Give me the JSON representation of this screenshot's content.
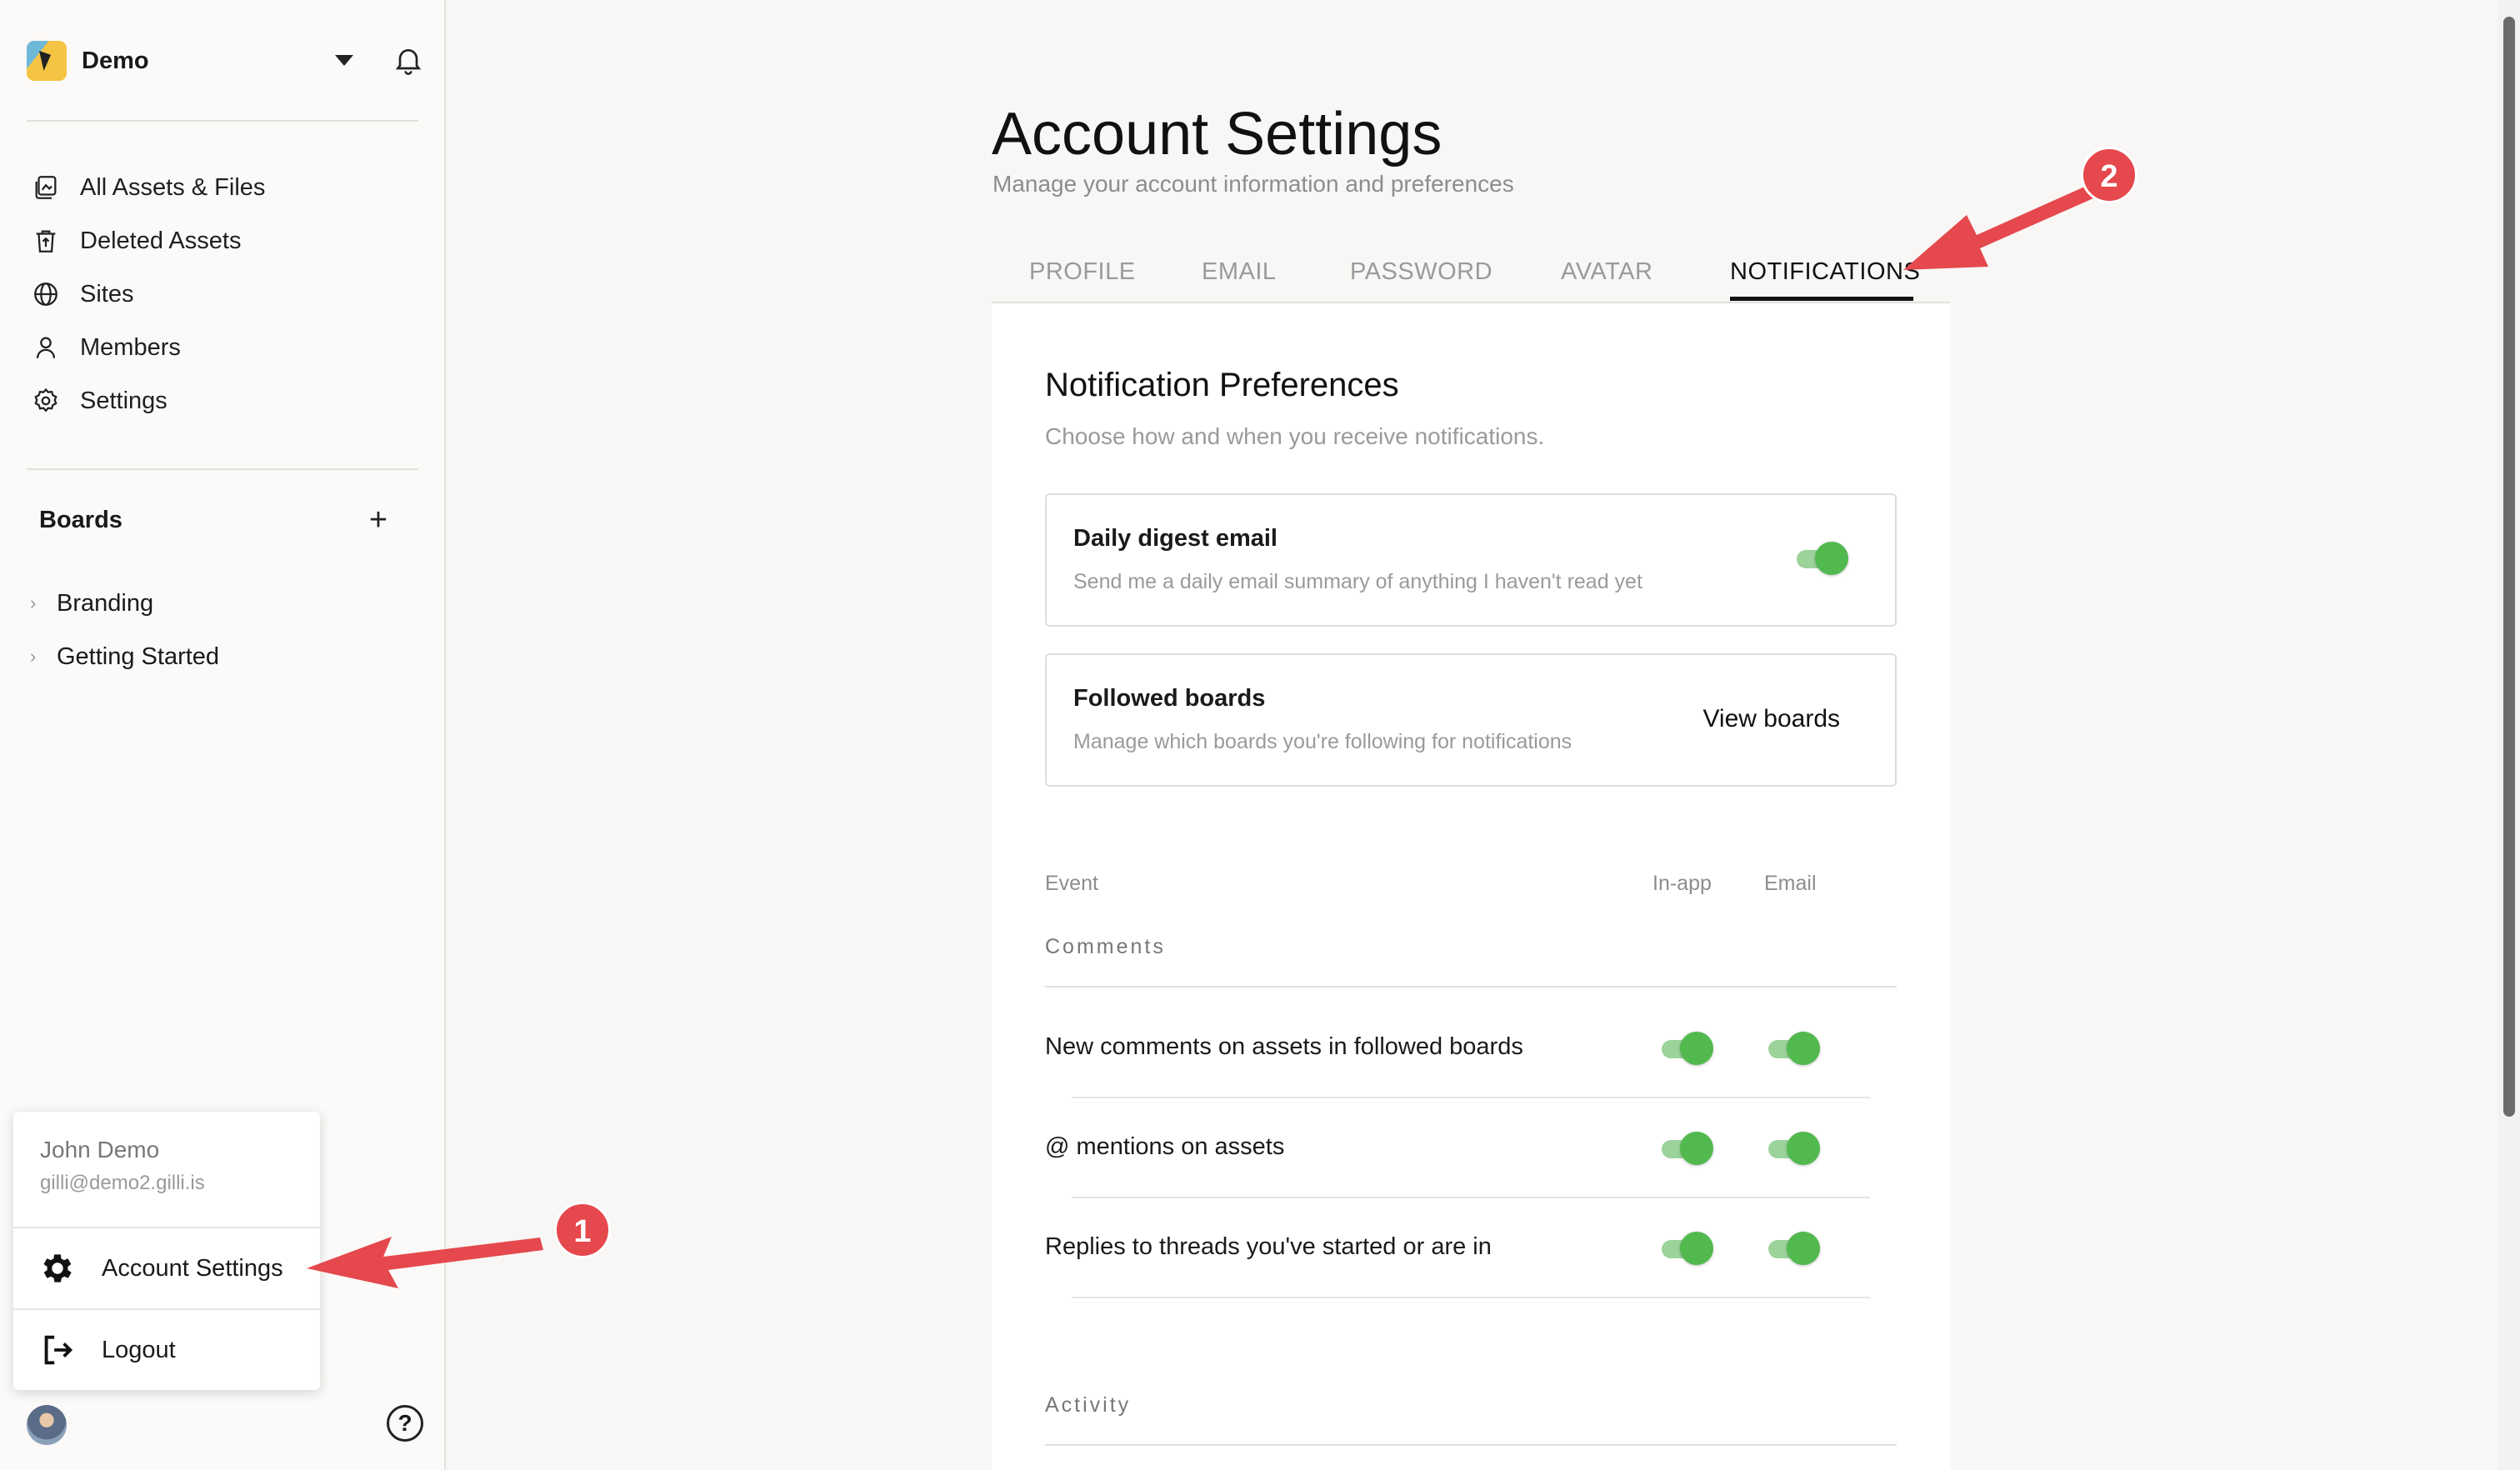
{
  "workspace": {
    "name": "Demo"
  },
  "nav": [
    {
      "label": "All Assets & Files",
      "icon": "assets-icon"
    },
    {
      "label": "Deleted Assets",
      "icon": "trash-icon"
    },
    {
      "label": "Sites",
      "icon": "globe-icon"
    },
    {
      "label": "Members",
      "icon": "person-icon"
    },
    {
      "label": "Settings",
      "icon": "gear-icon"
    }
  ],
  "boards": {
    "title": "Boards",
    "add_label": "+",
    "items": [
      {
        "label": "Branding"
      },
      {
        "label": "Getting Started"
      }
    ]
  },
  "user_menu": {
    "name": "John Demo",
    "email": "gilli@demo2.gilli.is",
    "account_settings": "Account Settings",
    "logout": "Logout"
  },
  "help_label": "?",
  "page": {
    "title": "Account Settings",
    "subtitle": "Manage your account information and preferences",
    "tabs": [
      {
        "label": "PROFILE"
      },
      {
        "label": "EMAIL"
      },
      {
        "label": "PASSWORD"
      },
      {
        "label": "AVATAR"
      },
      {
        "label": "NOTIFICATIONS",
        "active": true
      }
    ]
  },
  "notifications": {
    "title": "Notification Preferences",
    "subtitle": "Choose how and when you receive notifications.",
    "digest": {
      "title": "Daily digest email",
      "subtitle": "Send me a daily email summary of anything I haven't read yet",
      "enabled": true
    },
    "followed": {
      "title": "Followed boards",
      "subtitle": "Manage which boards you're following for notifications",
      "action": "View boards"
    },
    "columns": {
      "event": "Event",
      "inapp": "In-app",
      "email": "Email"
    },
    "groups": [
      {
        "label": "Comments",
        "rows": [
          {
            "label": "New comments on assets in followed boards",
            "inapp": true,
            "email": true
          },
          {
            "label": "@ mentions on assets",
            "inapp": true,
            "email": true
          },
          {
            "label": "Replies to threads you've started or are in",
            "inapp": true,
            "email": true
          }
        ]
      },
      {
        "label": "Activity",
        "rows": []
      }
    ]
  },
  "annotations": {
    "step1": "1",
    "step2": "2",
    "color": "#e5484d"
  },
  "colors": {
    "toggle_on": "#52b94f",
    "accent": "#111111"
  }
}
